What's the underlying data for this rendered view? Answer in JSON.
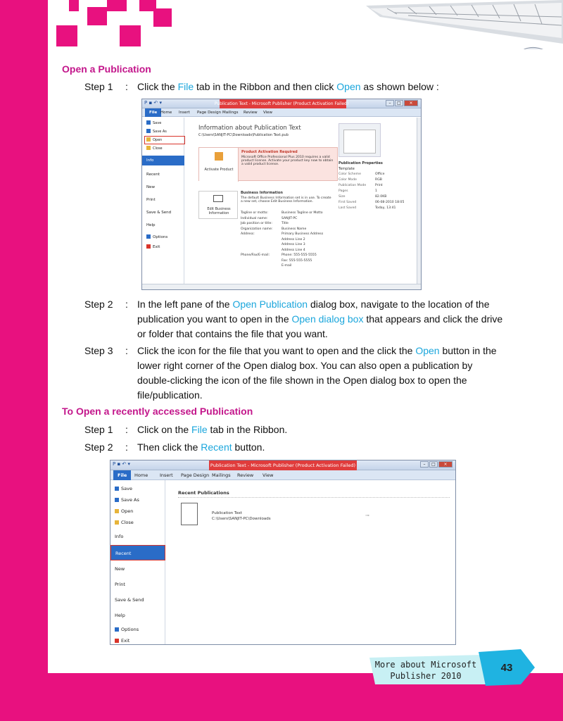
{
  "heading1": "Open a Publication",
  "steps1": [
    {
      "label": "Step 1",
      "parts": [
        "Click the ",
        "File",
        " tab in the Ribbon and then click ",
        "Open",
        " as shown below :"
      ]
    }
  ],
  "steps2": [
    {
      "label": "Step 2",
      "parts": [
        "In the left pane of the ",
        "Open Publication",
        " dialog box, navigate to the location of the publication you want to open in the ",
        "Open dialog box",
        " that appears and click the drive or folder that contains the file that you want."
      ]
    },
    {
      "label": "Step 3",
      "parts": [
        "Click the icon for the file that you want to open and the click the ",
        "Open",
        " button in the lower right corner of the Open dialog box. You can also open a publication by double-clicking the icon of the file shown in the Open dialog box to open the file/publication."
      ]
    }
  ],
  "heading2": "To Open a recently accessed Publication",
  "steps3": [
    {
      "label": "Step 1",
      "parts": [
        "Click on the ",
        "File",
        " tab in the Ribbon."
      ]
    },
    {
      "label": "Step 2",
      "parts": [
        "Then click the ",
        "Recent",
        " button."
      ]
    }
  ],
  "colon": ":",
  "shot1": {
    "title": "Publication Text - Microsoft Publisher (Product Activation Failed)",
    "tabs": [
      "File",
      "Home",
      "Insert",
      "Page Design",
      "Mailings",
      "Review",
      "View"
    ],
    "menu_top": [
      "Save",
      "Save As",
      "Open",
      "Close"
    ],
    "selected": "Info",
    "menu_bottom": [
      "Recent",
      "New",
      "Print",
      "Save & Send",
      "Help",
      "Options",
      "Exit"
    ],
    "info_title": "Information about Publication Text",
    "info_path": "C:\\Users\\SANJIT-PC\\Downloads\\Publication Text.pub",
    "activate_label": "Activate Product",
    "activation_title": "Product Activation Required",
    "activation_text": "Microsoft Office Professional Plus 2010 requires a valid product license. Activate your product key now to obtain a valid product license.",
    "edit_label": "Edit Business Information",
    "biz_title": "Business Information",
    "biz_text": "The default Business Information set is in use. To create a new set, choose Edit Business Information.",
    "biz_rows": [
      [
        "Tagline or motto:",
        "Business Tagline or Motto"
      ],
      [
        "Individual name:",
        "SANJIT-PC"
      ],
      [
        "Job position or title:",
        "Title"
      ],
      [
        "Organization name:",
        "Business Name"
      ],
      [
        "Address:",
        "Primary Business Address"
      ],
      [
        "",
        "Address Line 2"
      ],
      [
        "",
        "Address Line 3"
      ],
      [
        "",
        "Address Line 4"
      ],
      [
        "Phone/Fax/E-mail:",
        "Phone: 555-555-5555"
      ],
      [
        "",
        "Fax: 555-555-5555"
      ],
      [
        "",
        "E-mail"
      ]
    ],
    "props_title": "Publication Properties",
    "props_sub": "Template",
    "props": [
      [
        "Color Scheme",
        "Office"
      ],
      [
        "Color Mode",
        "RGB"
      ],
      [
        "Publication Mode",
        "Print"
      ],
      [
        "Pages",
        "1"
      ],
      [
        "Size",
        "82.0KB"
      ],
      [
        "First Saved",
        "06-08-2010 18:05"
      ],
      [
        "Last Saved",
        "Today, 13:41"
      ]
    ]
  },
  "shot2": {
    "title": "Publication Text - Microsoft Publisher (Product Activation Failed)",
    "tabs": [
      "File",
      "Home",
      "Insert",
      "Page Design",
      "Mailings",
      "Review",
      "View"
    ],
    "menu_top": [
      "Save",
      "Save As",
      "Open",
      "Close"
    ],
    "info": "Info",
    "selected": "Recent",
    "menu_bottom": [
      "New",
      "Print",
      "Save & Send",
      "Help",
      "Options",
      "Exit"
    ],
    "recent_title": "Recent Publications",
    "recent_item_name": "Publication Text",
    "recent_item_path": "C:\\Users\\SANJIT-PC\\Downloads"
  },
  "footer": {
    "line1": "More about Microsoft",
    "line2": "Publisher 2010",
    "page": "43"
  }
}
